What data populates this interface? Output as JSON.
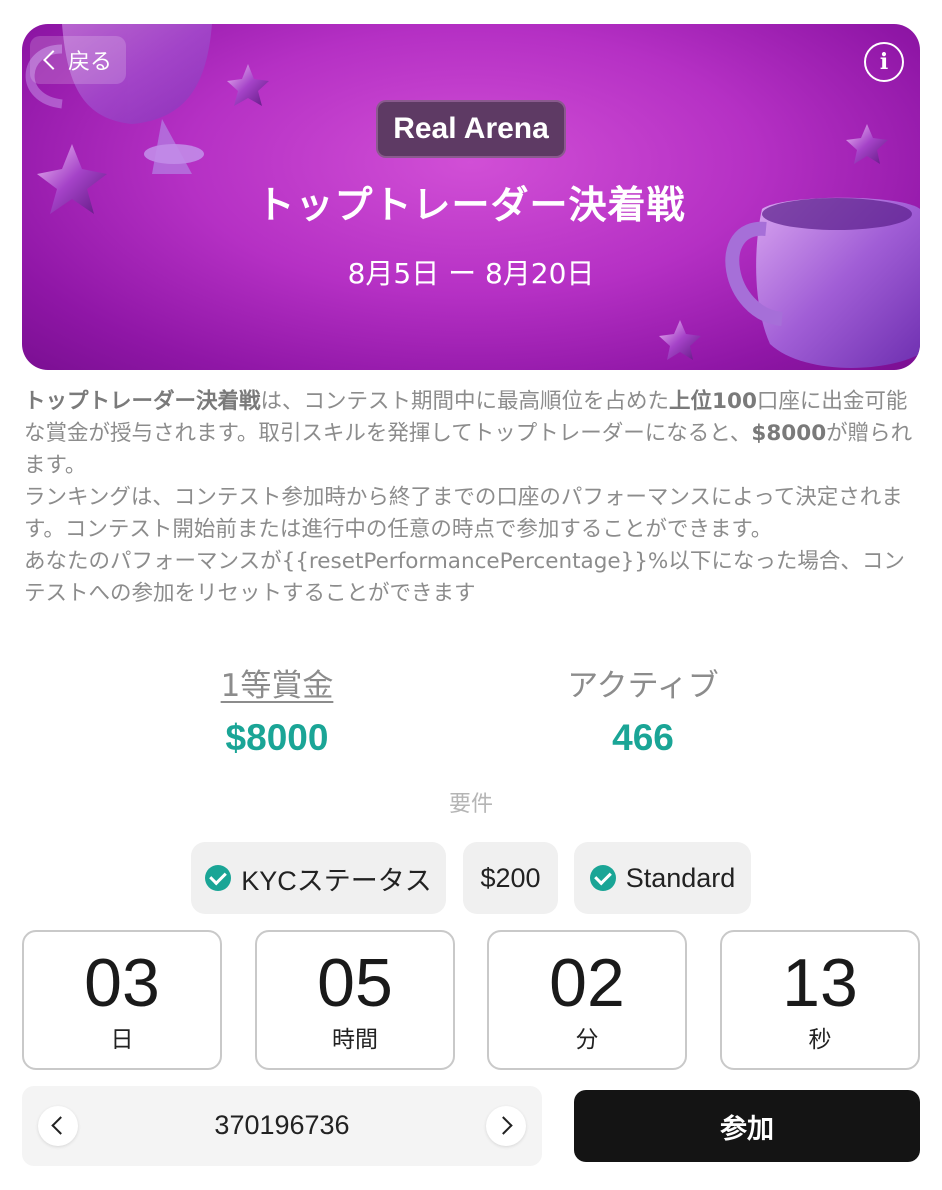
{
  "header": {
    "back_label": "戻る",
    "info_icon": "i",
    "badge": "Real Arena",
    "title": "トップトレーダー決着戦",
    "dates": "8月5日 ー 8月20日"
  },
  "description": {
    "p1_bold_title": "トップトレーダー決着戦",
    "p1_text_a": "は、コンテスト期間中に最高順位を占めた",
    "p1_bold_top": "上位100",
    "p1_text_b": "口座に出金可能な賞金が授与されます。取引スキルを発揮してトップトレーダーになると、",
    "p1_bold_amount": "$8000",
    "p1_text_c": "が贈られます。",
    "p2": "ランキングは、コンテスト参加時から終了までの口座のパフォーマンスによって決定されます。コンテスト開始前または進行中の任意の時点で参加することができます。",
    "p3": "あなたのパフォーマンスが{{resetPerformancePercentage}}%以下になった場合、コンテストへの参加をリセットすることができます"
  },
  "stats": {
    "prize_label": "1等賞金",
    "prize_value": "$8000",
    "active_label": "アクティブ",
    "active_value": "466"
  },
  "requirements": {
    "title": "要件",
    "items": [
      "KYCステータス",
      "$200",
      "Standard"
    ]
  },
  "countdown": [
    {
      "value": "03",
      "unit": "日"
    },
    {
      "value": "05",
      "unit": "時間"
    },
    {
      "value": "02",
      "unit": "分"
    },
    {
      "value": "13",
      "unit": "秒"
    }
  ],
  "account": {
    "number": "370196736"
  },
  "join_label": "参加",
  "colors": {
    "accent": "#1aa596",
    "banner": "#b530c4",
    "button": "#141414"
  }
}
